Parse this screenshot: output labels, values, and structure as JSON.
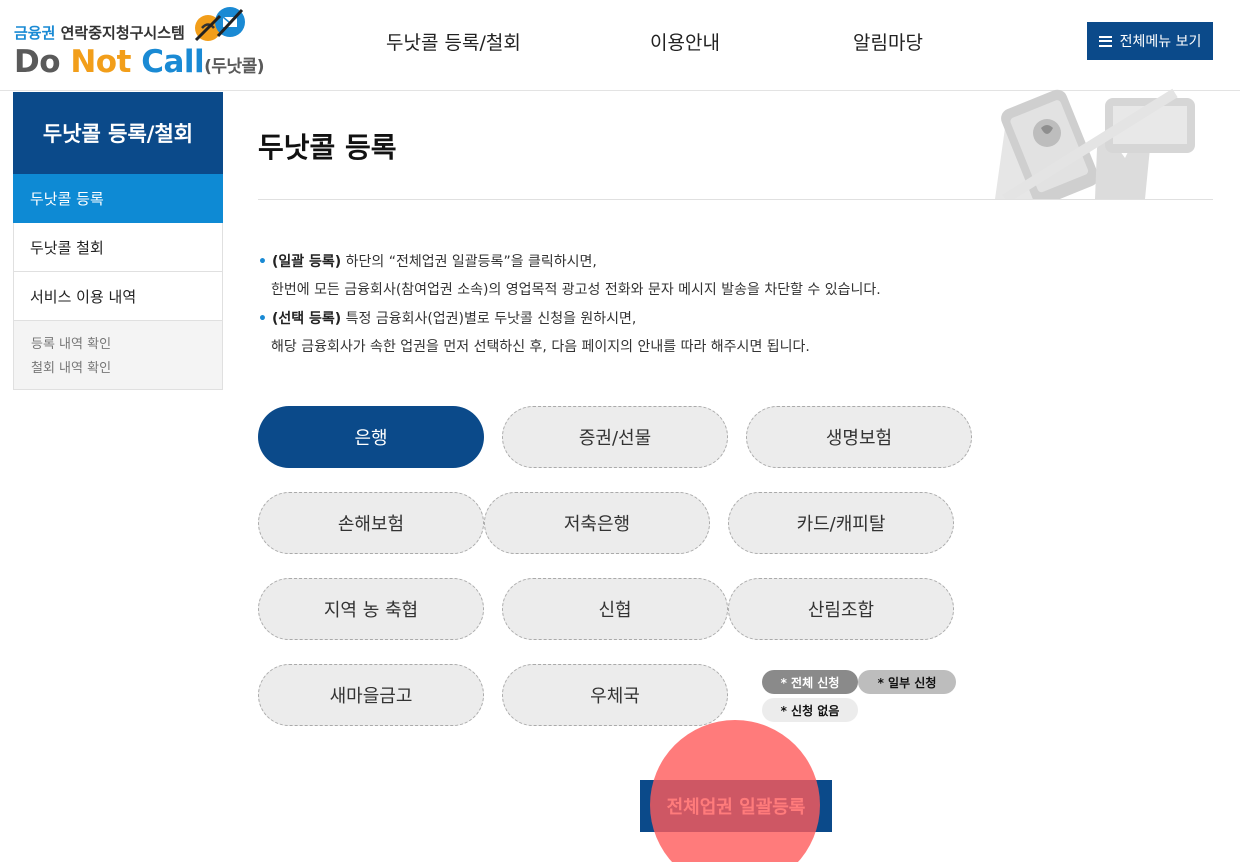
{
  "header": {
    "logo_line1_blue": "금융권",
    "logo_line1_dark": " 연락중지청구시스템",
    "logo_do": "Do ",
    "logo_not": "Not ",
    "logo_call": "Call",
    "logo_kr": "(두낫콜)",
    "nav": [
      "두낫콜 등록/철회",
      "이용안내",
      "알림마당"
    ],
    "menu_button": "전체메뉴 보기"
  },
  "sidebar": {
    "title": "두낫콜 등록/철회",
    "items": [
      {
        "label": "두낫콜 등록",
        "active": true
      },
      {
        "label": "두낫콜 철회",
        "active": false
      },
      {
        "label": "서비스 이용 내역",
        "active": false
      }
    ],
    "sub_items": [
      "등록 내역 확인",
      "철회 내역 확인"
    ]
  },
  "main": {
    "title": "두낫콜 등록",
    "bullets": [
      {
        "bullet": "•",
        "bold": "(일괄 등록)",
        "text1": " 하단의 “전체업권 일괄등록”을 클릭하시면,",
        "text2": "한번에 모든 금융회사(참여업권 소속)의 영업목적 광고성 전화와 문자 메시지 발송을 차단할 수 있습니다."
      },
      {
        "bullet": "•",
        "bold": "(선택 등록)",
        "text1": " 특정 금융회사(업권)별로 두낫콜 신청을 원하시면,",
        "text2": "해당 금융회사가 속한 업권을 먼저 선택하신 후, 다음 페이지의 안내를 따라 해주시면 됩니다."
      }
    ],
    "sectors": [
      {
        "label": "은행",
        "selected": true
      },
      {
        "label": "증권/선물",
        "selected": false
      },
      {
        "label": "생명보험",
        "selected": false
      },
      {
        "label": "손해보험",
        "selected": false
      },
      {
        "label": "저축은행",
        "selected": false
      },
      {
        "label": "카드/캐피탈",
        "selected": false
      },
      {
        "label": "지역 농 축협",
        "selected": false
      },
      {
        "label": "신협",
        "selected": false
      },
      {
        "label": "산림조합",
        "selected": false
      },
      {
        "label": "새마을금고",
        "selected": false
      },
      {
        "label": "우체국",
        "selected": false
      }
    ],
    "legend": {
      "all": "* 전체 신청",
      "some": "* 일부 신청",
      "none": "* 신청 없음"
    },
    "cta_label": "전체업권 일괄등록"
  },
  "colors": {
    "primary": "#0b4a8a",
    "accent_blue": "#0e8ad4",
    "pill_bg": "#ececec"
  }
}
